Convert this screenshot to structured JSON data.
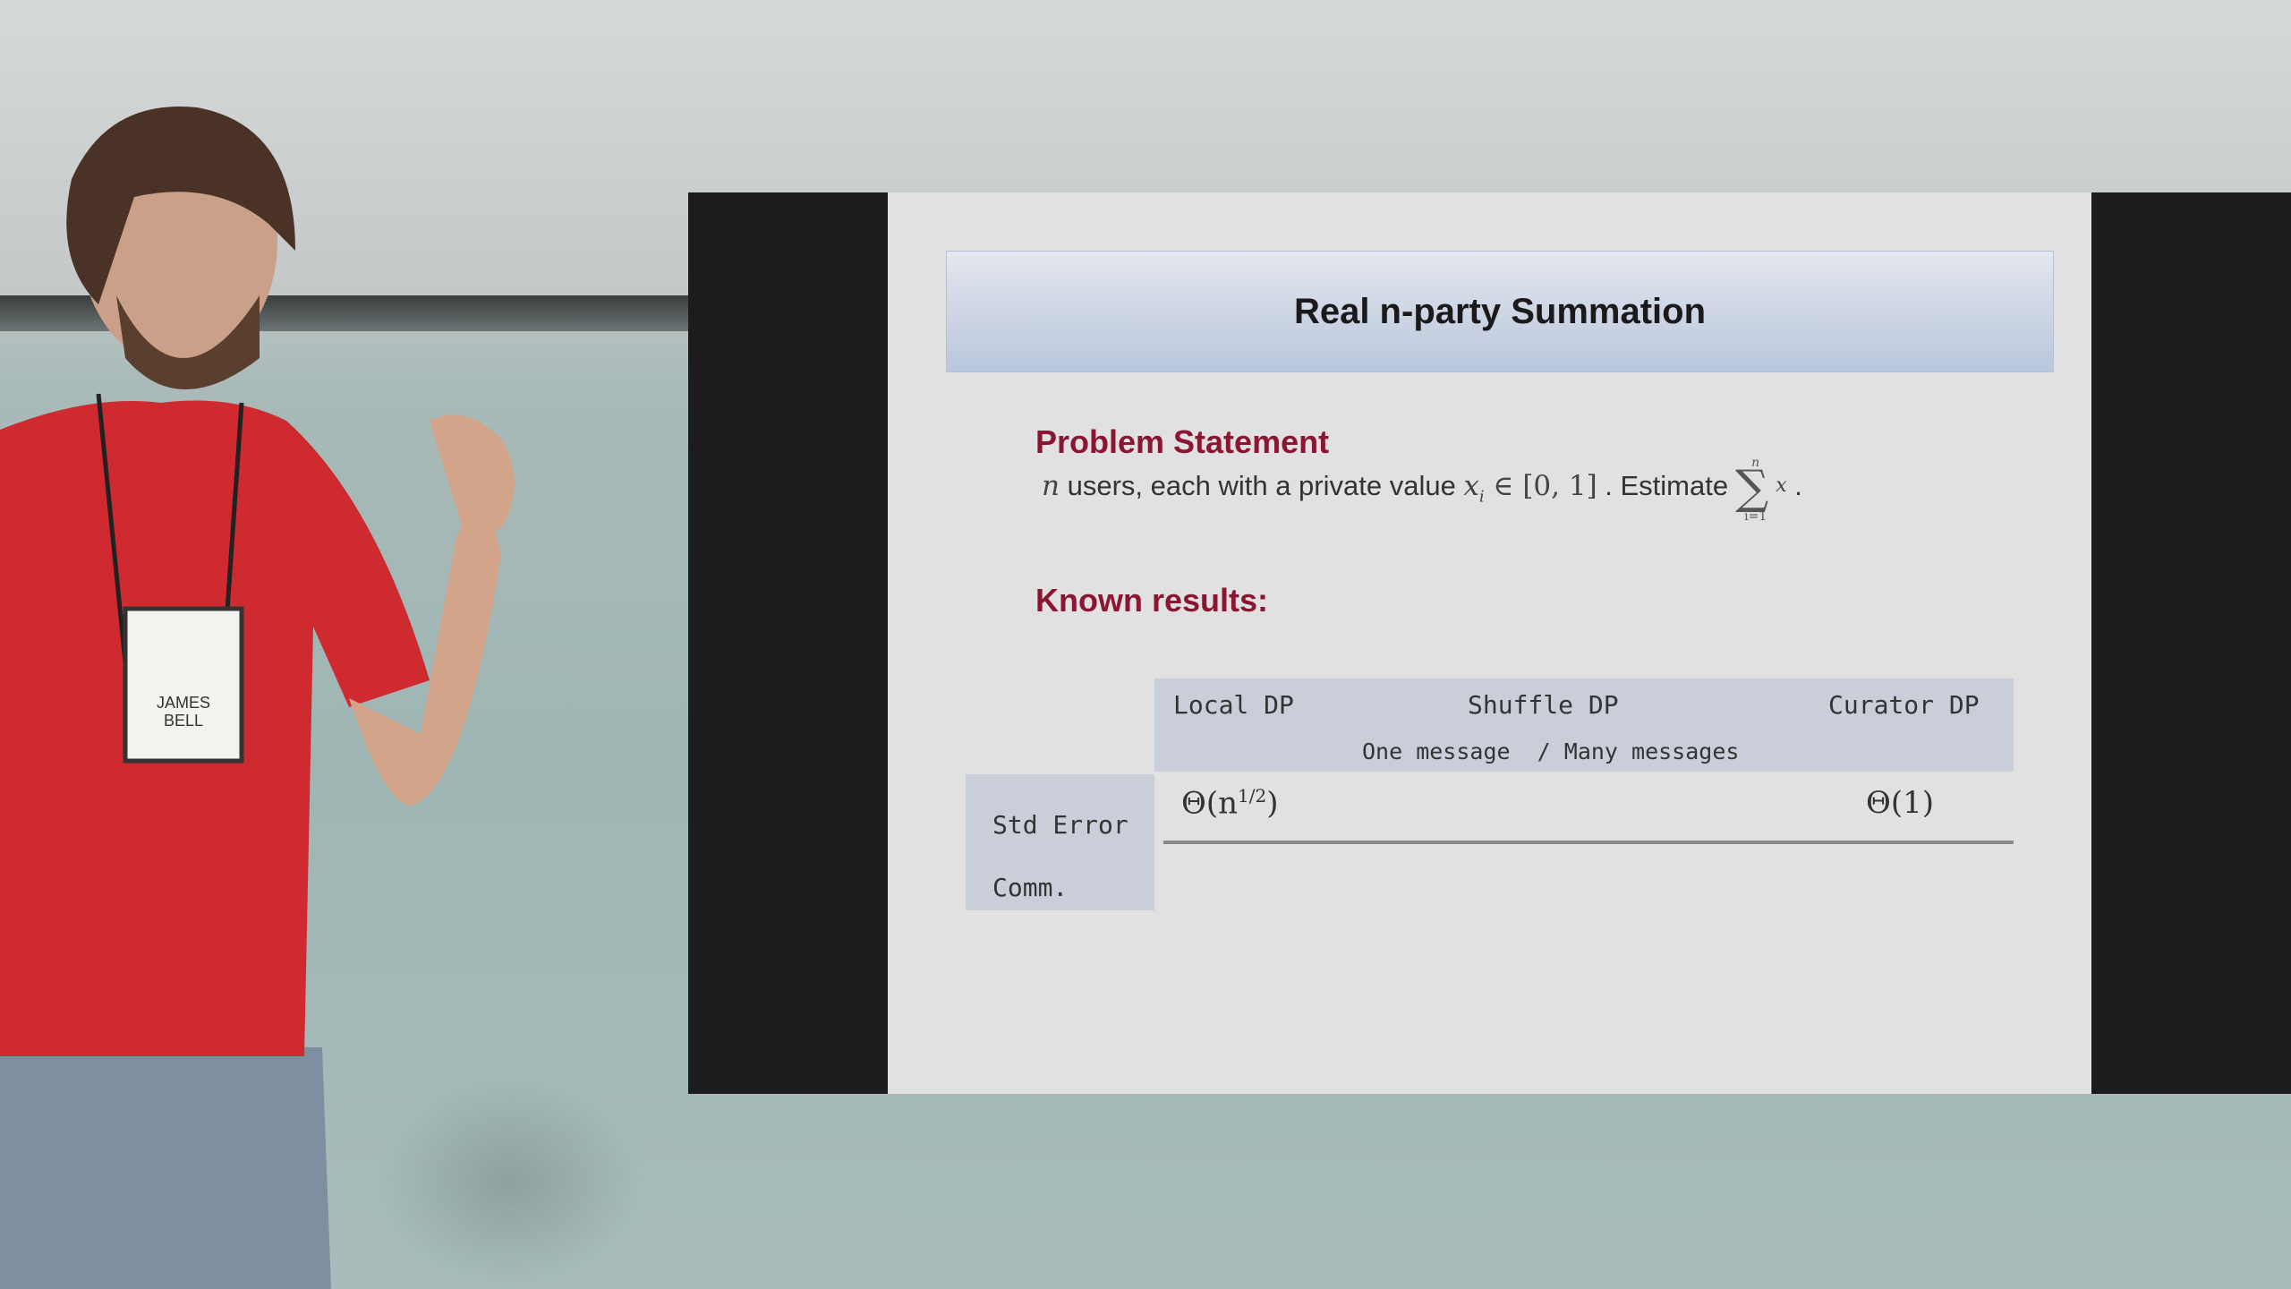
{
  "slide": {
    "title": "Real n-party Summation",
    "problem_heading": "Problem Statement",
    "problem_text": {
      "var_n": "n",
      "text1": " users, each with a private value ",
      "var_x": "x",
      "sub_i": "i",
      "membership": " ∈ [0, 1]",
      "text2": " . Estimate",
      "sum_symbol": "∑",
      "sum_upper": "n",
      "sum_lower": "i=1",
      "summand": "x",
      "end": " ."
    },
    "known_heading": "Known results:",
    "table": {
      "columns": [
        "Local DP",
        "Shuffle DP",
        "Curator DP"
      ],
      "subheader": "One message  / Many messages",
      "rows": [
        {
          "label": "Std Error",
          "local": "Θ(n",
          "local_sup": "1/2",
          "local_end": ")",
          "curator": "Θ(1)"
        },
        {
          "label": "Comm."
        }
      ]
    }
  },
  "speaker": {
    "badge_name_line1": "JAMES",
    "badge_name_line2": "BELL"
  }
}
